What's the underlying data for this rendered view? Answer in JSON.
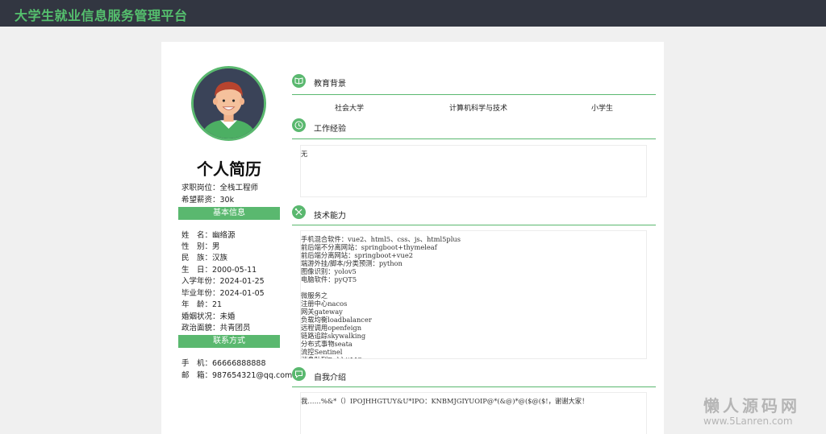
{
  "app": {
    "title": "大学生就业信息服务管理平台"
  },
  "profile": {
    "heading": "个人简历",
    "job_label": "求职岗位：",
    "job_value": "全栈工程师",
    "salary_label": "希望薪资：",
    "salary_value": "30k"
  },
  "basic": {
    "title": "基本信息",
    "rows": [
      {
        "label": "姓　名：",
        "value": "幽络源"
      },
      {
        "label": "性　别：",
        "value": "男"
      },
      {
        "label": "民　族：",
        "value": "汉族"
      },
      {
        "label": "生　日：",
        "value": "2000-05-11"
      },
      {
        "label": "入学年份：",
        "value": "2024-01-25"
      },
      {
        "label": "毕业年份：",
        "value": "2024-01-05"
      },
      {
        "label": "年　龄：",
        "value": "21"
      },
      {
        "label": "婚姻状况：",
        "value": "未婚"
      },
      {
        "label": "政治面貌：",
        "value": "共青团员"
      }
    ]
  },
  "contact": {
    "title": "联系方式",
    "rows": [
      {
        "label": "手　机：",
        "value": "66666888888"
      },
      {
        "label": "邮　箱：",
        "value": "987654321@qq.com"
      }
    ]
  },
  "education": {
    "title": "教育背景",
    "school": "社会大学",
    "major": "计算机科学与技术",
    "degree": "小学生"
  },
  "work": {
    "title": "工作经验",
    "content": "无"
  },
  "skills": {
    "title": "技术能力",
    "content": "手机混合软件：vue2、html5、css、js、html5plus\n前后端不分离网站：springboot+thymeleaf\n前后端分离网站：springboot+vue2\n端游外挂/脚本/分类预测：python\n图像识别：yolov5\n电脑软件：pyQT5\n\n微服务之\n注册中心nacos\n网关gateway\n负载均衡loadbalancer\n远程调用openfeign\n链路追踪skywalking\n分布式事物seata\n流控Sentinel\n消息队列RabbitMQ"
  },
  "intro": {
    "title": "自我介绍",
    "content": "我……%&*（）IPOJHHGTUY&U*IPO：KNBMJGIYUOIP@*(&@)*@($@($!，谢谢大家！"
  },
  "watermark": {
    "line1": "懒人源码网",
    "line2": "www.5Lanren.com"
  },
  "colors": {
    "accent": "#5ab86f",
    "topbar": "#323641",
    "brand_text": "#55c06e"
  },
  "icons": {
    "education": "book-icon",
    "work": "clock-icon",
    "skills": "tools-icon",
    "intro": "chat-icon"
  }
}
